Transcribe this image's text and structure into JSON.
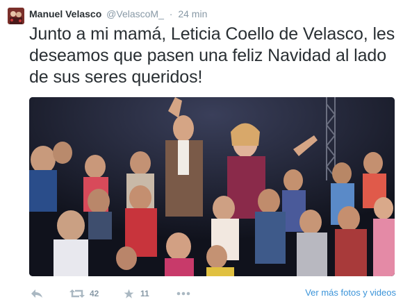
{
  "author": {
    "fullname": "Manuel Velasco",
    "username": "@VelascoM_",
    "time": "24 min"
  },
  "tweet": {
    "text": "Junto a mi mamá, Leticia Coello de Velasco, les deseamos que pasen una feliz Navidad al lado de sus seres queridos!"
  },
  "actions": {
    "reply_icon": "reply-icon",
    "retweet_icon": "retweet-icon",
    "retweet_count": "42",
    "favorite_icon": "star-icon",
    "favorite_count": "11",
    "more_icon": "more-dots-icon",
    "media_link": "Ver más fotos y videos"
  },
  "colors": {
    "text": "#292f33",
    "secondary": "#8899a6",
    "link": "#3b94d9",
    "icon": "#aab8c2"
  }
}
